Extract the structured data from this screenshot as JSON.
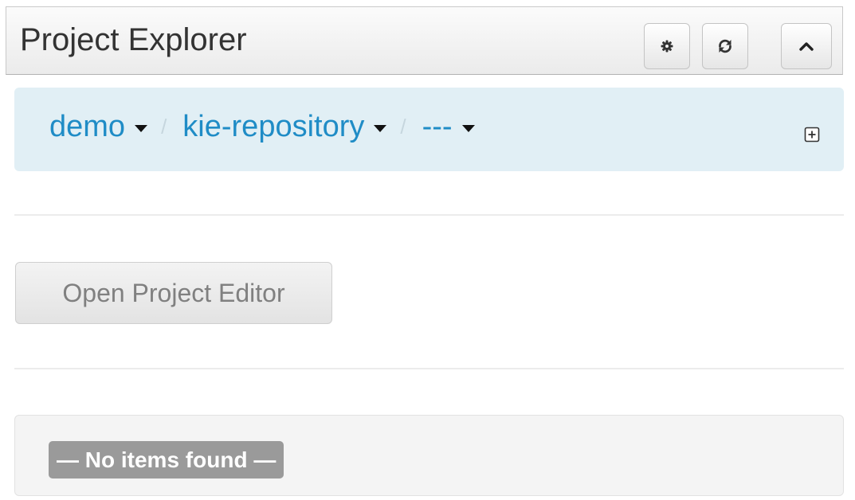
{
  "header": {
    "title": "Project Explorer"
  },
  "breadcrumb": {
    "items": [
      {
        "label": "demo"
      },
      {
        "label": "kie-repository"
      },
      {
        "label": "---"
      }
    ],
    "separator": "/"
  },
  "actions": {
    "open_project_editor_label": "Open Project Editor"
  },
  "list": {
    "empty_message": "— No items found —"
  },
  "colors": {
    "link": "#1f8cc6",
    "breadcrumb_bg": "#e1eff5",
    "badge_bg": "#9a9a9a"
  },
  "icons": {
    "settings": "gear-icon",
    "refresh": "refresh-icon",
    "collapse": "chevron-up-icon",
    "add": "plus-square-icon"
  }
}
